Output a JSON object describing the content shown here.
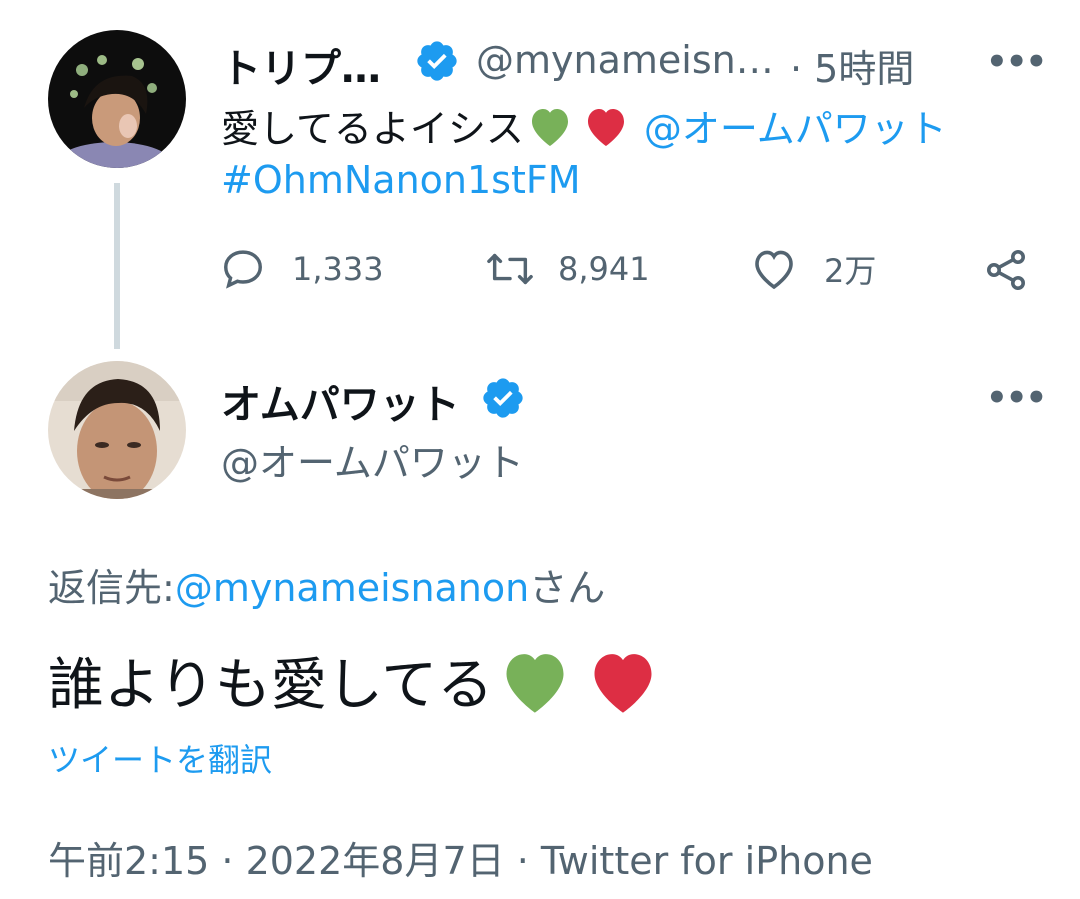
{
  "tweet1": {
    "display_name": "トリプ…",
    "handle": "@mynameisn…",
    "time": "· 5時間",
    "text": "愛してるよイシス",
    "emoji_heart_green": "💚",
    "emoji_heart_red": "❤️",
    "mention": "@オームパワット",
    "hashtag": "#OhmNanon1stFM",
    "replies": "1,333",
    "retweets": "8,941",
    "likes": "2万",
    "more_label": "•••"
  },
  "tweet2": {
    "display_name": "オムパワット",
    "handle": "@オームパワット",
    "more_label": "•••",
    "reply_prefix": "返信先:",
    "reply_mention": "@mynameisnanon",
    "reply_suffix": "さん",
    "text": "誰よりも愛してる",
    "emoji_heart_green": "💚",
    "emoji_heart_red": "❤️",
    "translate": "ツイートを翻訳",
    "timestamp": "午前2:15 · 2022年8月7日 · Twitter for iPhone"
  },
  "colors": {
    "accent_blue": "#1d9bf0",
    "secondary_gray": "#536471",
    "heart_green": "#78b159",
    "heart_red": "#dd2e44",
    "thread_line": "#cfd9de"
  },
  "icons": {
    "reply": "comment-bubble-icon",
    "retweet": "retweet-icon",
    "like": "heart-outline-icon",
    "share": "share-icon",
    "verified": "verified-badge-icon"
  }
}
